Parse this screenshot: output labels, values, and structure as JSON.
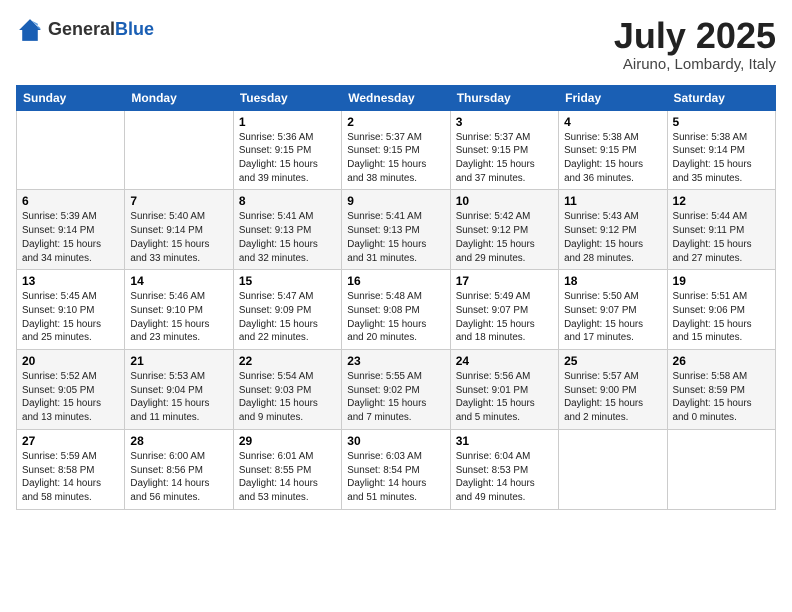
{
  "header": {
    "logo_general": "General",
    "logo_blue": "Blue",
    "month_title": "July 2025",
    "location": "Airuno, Lombardy, Italy"
  },
  "weekdays": [
    "Sunday",
    "Monday",
    "Tuesday",
    "Wednesday",
    "Thursday",
    "Friday",
    "Saturday"
  ],
  "weeks": [
    [
      {
        "day": "",
        "info": ""
      },
      {
        "day": "",
        "info": ""
      },
      {
        "day": "1",
        "info": "Sunrise: 5:36 AM\nSunset: 9:15 PM\nDaylight: 15 hours\nand 39 minutes."
      },
      {
        "day": "2",
        "info": "Sunrise: 5:37 AM\nSunset: 9:15 PM\nDaylight: 15 hours\nand 38 minutes."
      },
      {
        "day": "3",
        "info": "Sunrise: 5:37 AM\nSunset: 9:15 PM\nDaylight: 15 hours\nand 37 minutes."
      },
      {
        "day": "4",
        "info": "Sunrise: 5:38 AM\nSunset: 9:15 PM\nDaylight: 15 hours\nand 36 minutes."
      },
      {
        "day": "5",
        "info": "Sunrise: 5:38 AM\nSunset: 9:14 PM\nDaylight: 15 hours\nand 35 minutes."
      }
    ],
    [
      {
        "day": "6",
        "info": "Sunrise: 5:39 AM\nSunset: 9:14 PM\nDaylight: 15 hours\nand 34 minutes."
      },
      {
        "day": "7",
        "info": "Sunrise: 5:40 AM\nSunset: 9:14 PM\nDaylight: 15 hours\nand 33 minutes."
      },
      {
        "day": "8",
        "info": "Sunrise: 5:41 AM\nSunset: 9:13 PM\nDaylight: 15 hours\nand 32 minutes."
      },
      {
        "day": "9",
        "info": "Sunrise: 5:41 AM\nSunset: 9:13 PM\nDaylight: 15 hours\nand 31 minutes."
      },
      {
        "day": "10",
        "info": "Sunrise: 5:42 AM\nSunset: 9:12 PM\nDaylight: 15 hours\nand 29 minutes."
      },
      {
        "day": "11",
        "info": "Sunrise: 5:43 AM\nSunset: 9:12 PM\nDaylight: 15 hours\nand 28 minutes."
      },
      {
        "day": "12",
        "info": "Sunrise: 5:44 AM\nSunset: 9:11 PM\nDaylight: 15 hours\nand 27 minutes."
      }
    ],
    [
      {
        "day": "13",
        "info": "Sunrise: 5:45 AM\nSunset: 9:10 PM\nDaylight: 15 hours\nand 25 minutes."
      },
      {
        "day": "14",
        "info": "Sunrise: 5:46 AM\nSunset: 9:10 PM\nDaylight: 15 hours\nand 23 minutes."
      },
      {
        "day": "15",
        "info": "Sunrise: 5:47 AM\nSunset: 9:09 PM\nDaylight: 15 hours\nand 22 minutes."
      },
      {
        "day": "16",
        "info": "Sunrise: 5:48 AM\nSunset: 9:08 PM\nDaylight: 15 hours\nand 20 minutes."
      },
      {
        "day": "17",
        "info": "Sunrise: 5:49 AM\nSunset: 9:07 PM\nDaylight: 15 hours\nand 18 minutes."
      },
      {
        "day": "18",
        "info": "Sunrise: 5:50 AM\nSunset: 9:07 PM\nDaylight: 15 hours\nand 17 minutes."
      },
      {
        "day": "19",
        "info": "Sunrise: 5:51 AM\nSunset: 9:06 PM\nDaylight: 15 hours\nand 15 minutes."
      }
    ],
    [
      {
        "day": "20",
        "info": "Sunrise: 5:52 AM\nSunset: 9:05 PM\nDaylight: 15 hours\nand 13 minutes."
      },
      {
        "day": "21",
        "info": "Sunrise: 5:53 AM\nSunset: 9:04 PM\nDaylight: 15 hours\nand 11 minutes."
      },
      {
        "day": "22",
        "info": "Sunrise: 5:54 AM\nSunset: 9:03 PM\nDaylight: 15 hours\nand 9 minutes."
      },
      {
        "day": "23",
        "info": "Sunrise: 5:55 AM\nSunset: 9:02 PM\nDaylight: 15 hours\nand 7 minutes."
      },
      {
        "day": "24",
        "info": "Sunrise: 5:56 AM\nSunset: 9:01 PM\nDaylight: 15 hours\nand 5 minutes."
      },
      {
        "day": "25",
        "info": "Sunrise: 5:57 AM\nSunset: 9:00 PM\nDaylight: 15 hours\nand 2 minutes."
      },
      {
        "day": "26",
        "info": "Sunrise: 5:58 AM\nSunset: 8:59 PM\nDaylight: 15 hours\nand 0 minutes."
      }
    ],
    [
      {
        "day": "27",
        "info": "Sunrise: 5:59 AM\nSunset: 8:58 PM\nDaylight: 14 hours\nand 58 minutes."
      },
      {
        "day": "28",
        "info": "Sunrise: 6:00 AM\nSunset: 8:56 PM\nDaylight: 14 hours\nand 56 minutes."
      },
      {
        "day": "29",
        "info": "Sunrise: 6:01 AM\nSunset: 8:55 PM\nDaylight: 14 hours\nand 53 minutes."
      },
      {
        "day": "30",
        "info": "Sunrise: 6:03 AM\nSunset: 8:54 PM\nDaylight: 14 hours\nand 51 minutes."
      },
      {
        "day": "31",
        "info": "Sunrise: 6:04 AM\nSunset: 8:53 PM\nDaylight: 14 hours\nand 49 minutes."
      },
      {
        "day": "",
        "info": ""
      },
      {
        "day": "",
        "info": ""
      }
    ]
  ]
}
